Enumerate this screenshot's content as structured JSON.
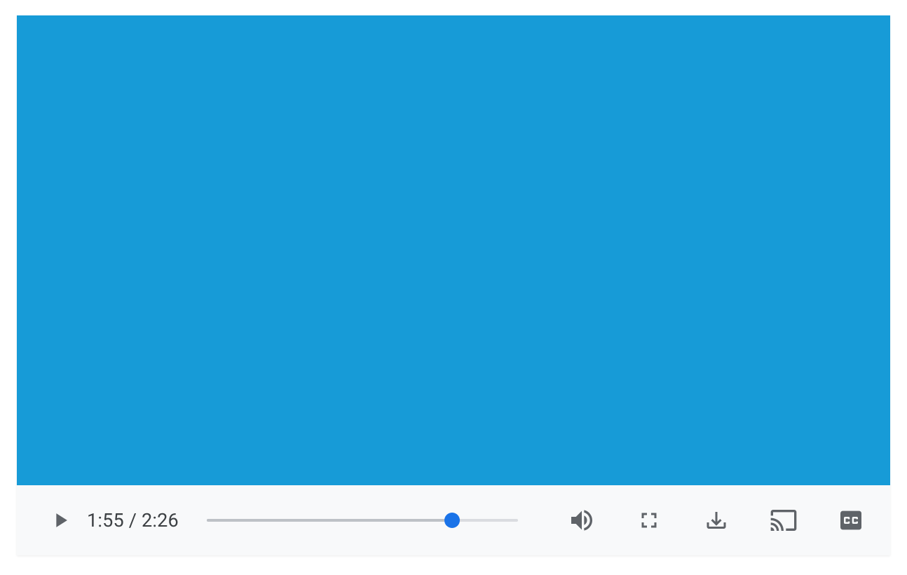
{
  "player": {
    "video_bg": "#179bd7",
    "current_time": "1:55",
    "duration": "2:26",
    "time_separator": " / ",
    "progress_percent": 78.8
  }
}
